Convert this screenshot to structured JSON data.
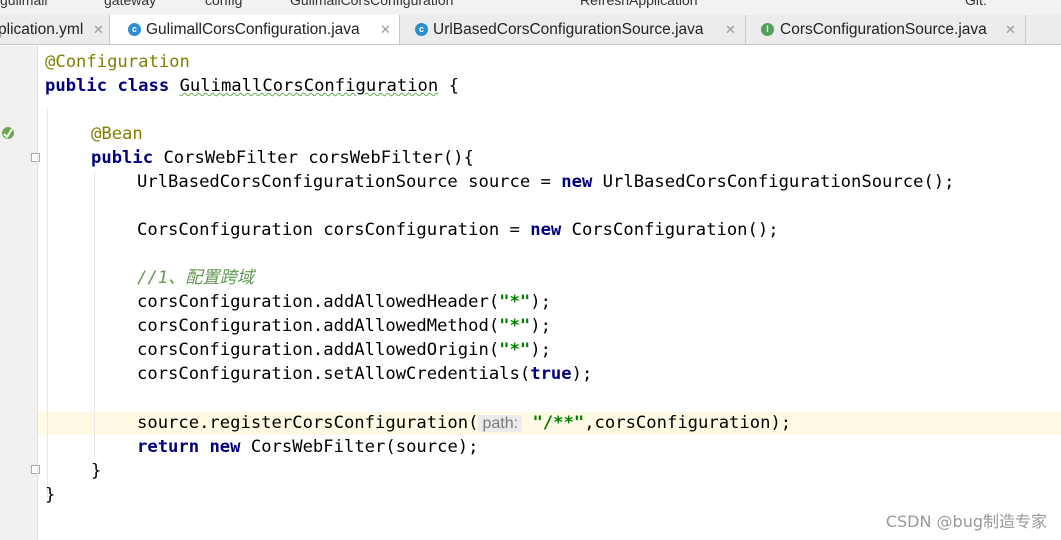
{
  "breadcrumb": [
    "gulimall",
    "gateway",
    "config",
    "GulimallCorsConfiguration",
    "RefreshApplication",
    "Git:"
  ],
  "tabs": [
    {
      "label": "plication.yml",
      "icon": "yml-file-icon",
      "active": false
    },
    {
      "label": "GulimallCorsConfiguration.java",
      "icon": "class-icon",
      "active": true
    },
    {
      "label": "UrlBasedCorsConfigurationSource.java",
      "icon": "class-icon",
      "active": false
    },
    {
      "label": "CorsConfigurationSource.java",
      "icon": "interface-icon",
      "active": false
    }
  ],
  "code": {
    "l1_ann": "@Configuration",
    "l2_kw1": "public",
    "l2_kw2": "class",
    "l2_name": "GulimallCorsConfiguration",
    "l2_rest": " {",
    "l4_ann": "@Bean",
    "l5_kw": "public",
    "l5_rest": " CorsWebFilter corsWebFilter(){",
    "l6_a": "UrlBasedCorsConfigurationSource source = ",
    "l6_kw": "new",
    "l6_b": " UrlBasedCorsConfigurationSource();",
    "l8_a": "CorsConfiguration corsConfiguration = ",
    "l8_kw": "new",
    "l8_b": " CorsConfiguration();",
    "l10_cmt": "//1、配置跨域",
    "l11_a": "corsConfiguration.addAllowedHeader(",
    "l11_s": "\"*\"",
    "l11_b": ");",
    "l12_a": "corsConfiguration.addAllowedMethod(",
    "l12_s": "\"*\"",
    "l12_b": ");",
    "l13_a": "corsConfiguration.addAllowedOrigin(",
    "l13_s": "\"*\"",
    "l13_b": ");",
    "l14_a": "corsConfiguration.setAllowCredentials(",
    "l14_kw": "true",
    "l14_b": ");",
    "l16_a": "source.registerCorsConfiguration(",
    "l16_hint": "path:",
    "l16_s": "\"/**\"",
    "l16_b": ",corsConfiguration);",
    "l17_kw1": "return",
    "l17_kw2": "new",
    "l17_rest": " CorsWebFilter(source);",
    "l18": "}",
    "l19": "}"
  },
  "watermark": "CSDN @bug制造专家",
  "colors": {
    "annotation": "#808000",
    "keyword": "#000080",
    "string": "#008000",
    "comment": "#629755",
    "caret_line": "#fffae3"
  }
}
